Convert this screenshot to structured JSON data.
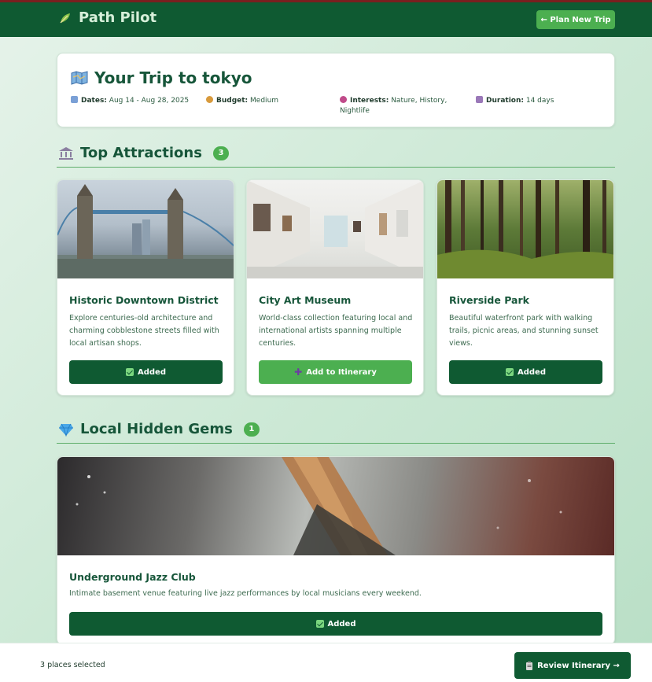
{
  "header": {
    "app_name": "Path Pilot",
    "logo_icon": "leaf-icon",
    "plan_button": "← Plan New Trip"
  },
  "trip": {
    "title": "Your Trip to tokyo",
    "title_icon": "map-icon",
    "dates_label": "Dates:",
    "dates_value": "Aug 14 - Aug 28, 2025",
    "budget_label": "Budget:",
    "budget_value": "Medium",
    "interests_label": "Interests:",
    "interests_value": "Nature, History, Nightlife",
    "duration_label": "Duration:",
    "duration_value": "14 days"
  },
  "sections": {
    "attractions": {
      "title": "Top Attractions",
      "count": "3",
      "icon": "museum-icon"
    },
    "gems": {
      "title": "Local Hidden Gems",
      "count": "1",
      "icon": "gem-icon"
    }
  },
  "attractions": [
    {
      "name": "Historic Downtown District",
      "desc": "Explore centuries-old architecture and charming cobblestone streets filled with local artisan shops.",
      "button": "Added",
      "state": "added"
    },
    {
      "name": "City Art Museum",
      "desc": "World-class collection featuring local and international artists spanning multiple centuries.",
      "button": "Add to Itinerary",
      "state": "add"
    },
    {
      "name": "Riverside Park",
      "desc": "Beautiful waterfront park with walking trails, picnic areas, and stunning sunset views.",
      "button": "Added",
      "state": "added"
    }
  ],
  "gems": [
    {
      "name": "Underground Jazz Club",
      "desc": "Intimate basement venue featuring live jazz performances by local musicians every weekend.",
      "button": "Added",
      "state": "added"
    }
  ],
  "footer": {
    "selected_text": "3 places selected",
    "review_button": "Review Itinerary →"
  },
  "colors": {
    "header_bg": "#0f5a32",
    "accent": "#4caf50",
    "primary_button": "#0f5a32"
  }
}
